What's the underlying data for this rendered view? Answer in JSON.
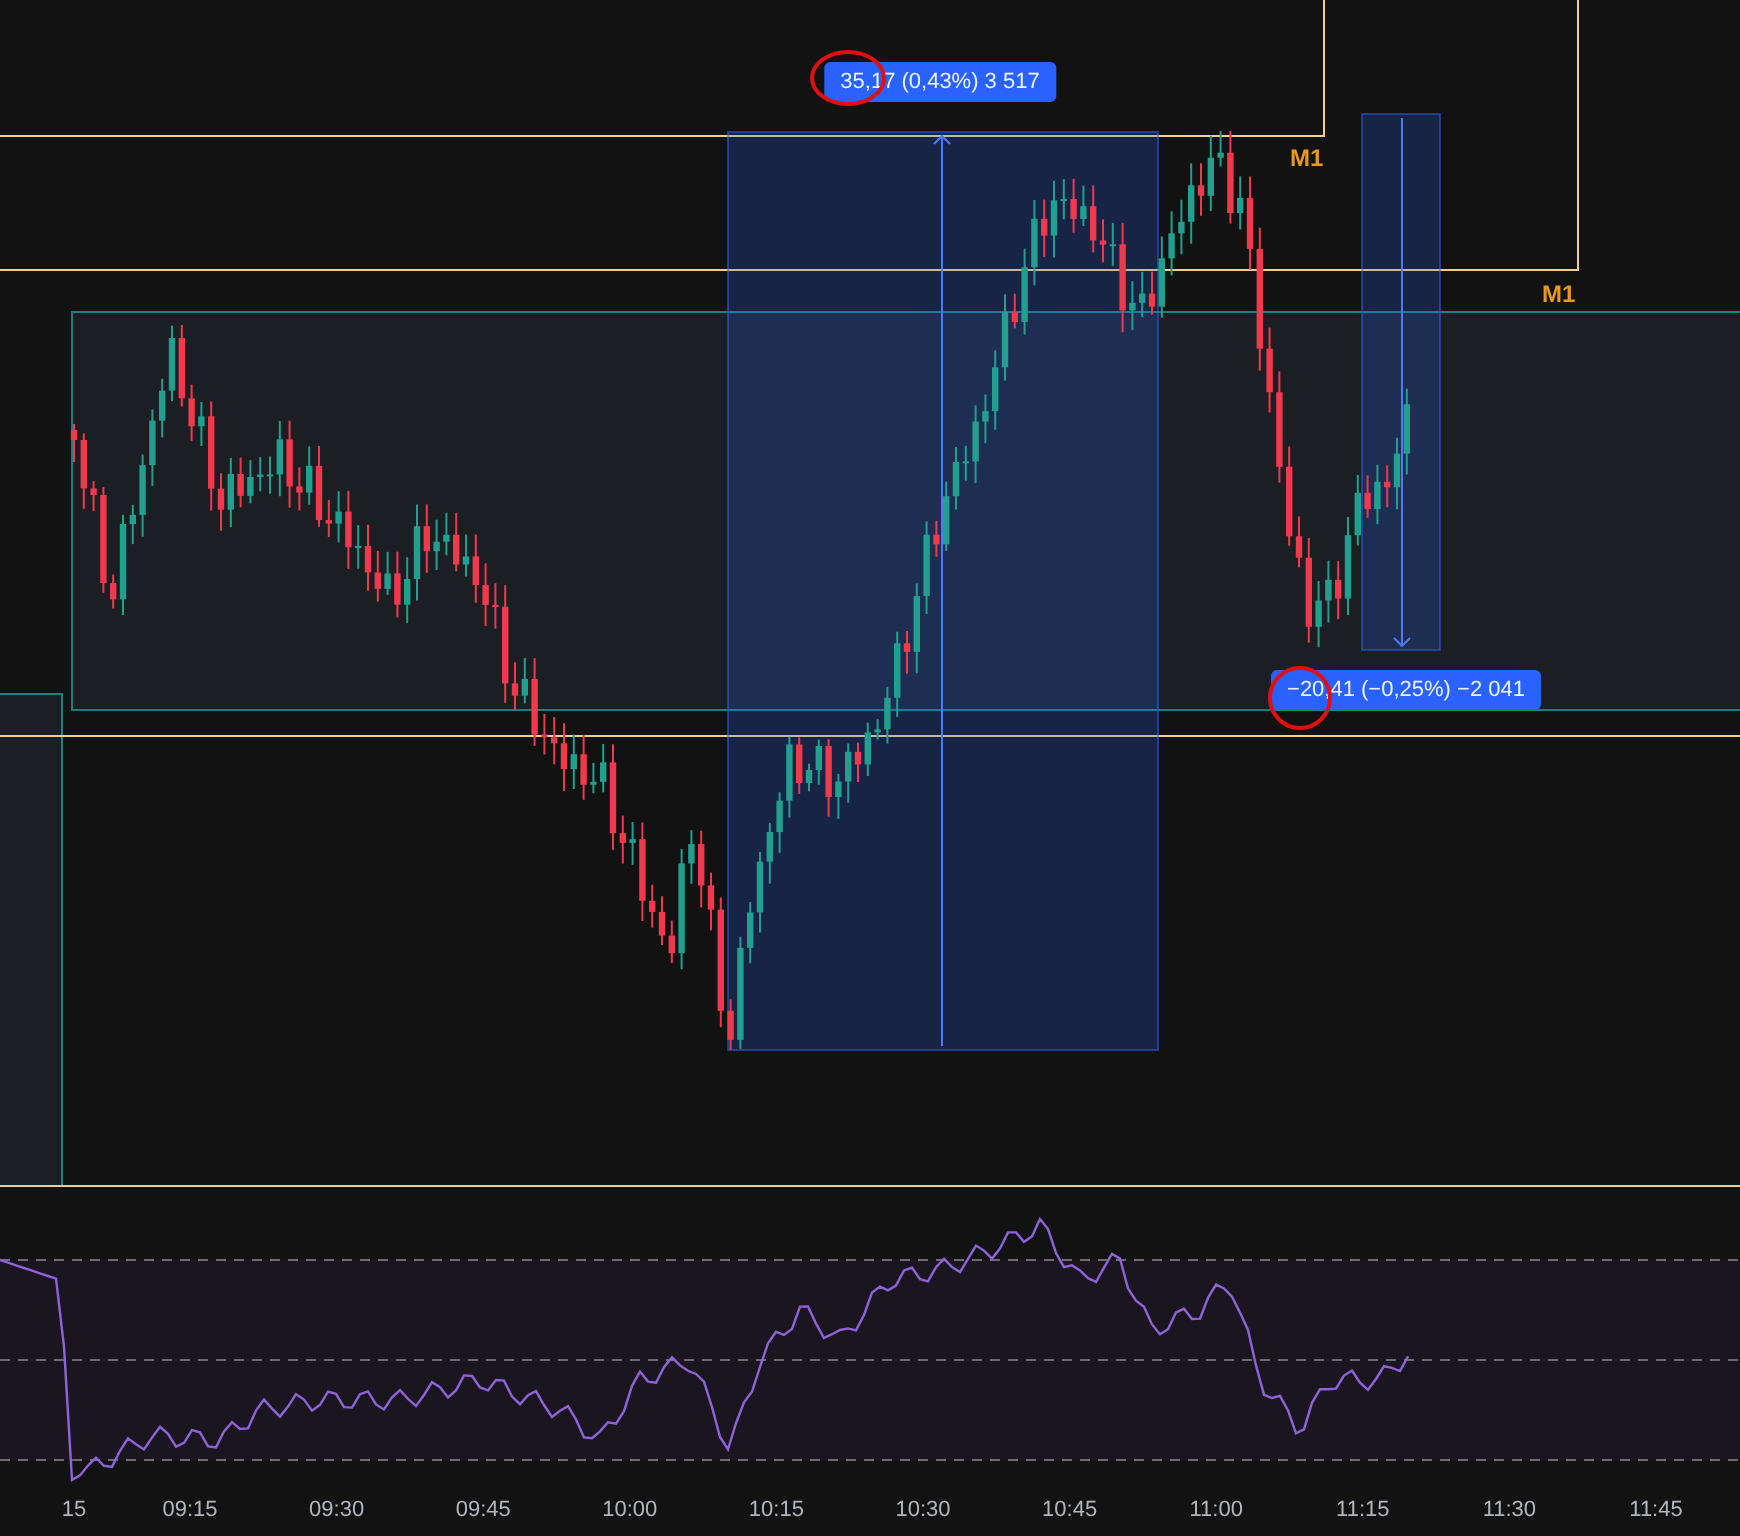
{
  "measurements": [
    {
      "text": "35,17 (0,43%) 3 517",
      "kind": "up"
    },
    {
      "text": "−20,41 (−0,25%) −2 041",
      "kind": "down"
    }
  ],
  "level_labels": [
    "M1",
    "M1"
  ],
  "time_axis": [
    "15",
    "09:15",
    "09:30",
    "09:45",
    "10:00",
    "10:15",
    "10:30",
    "10:45",
    "11:00",
    "11:15",
    "11:30",
    "11:45"
  ]
}
